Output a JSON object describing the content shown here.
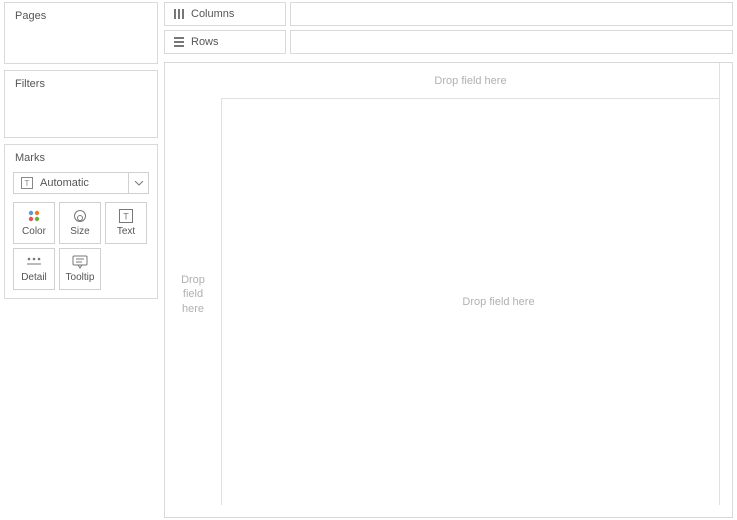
{
  "sidebar": {
    "pages": {
      "title": "Pages"
    },
    "filters": {
      "title": "Filters"
    },
    "marks": {
      "title": "Marks",
      "mark_type": {
        "label": "Automatic"
      },
      "buttons": {
        "color": "Color",
        "size": "Size",
        "text": "Text",
        "detail": "Detail",
        "tooltip": "Tooltip"
      }
    }
  },
  "shelves": {
    "columns": {
      "label": "Columns"
    },
    "rows": {
      "label": "Rows"
    }
  },
  "viz": {
    "col_placeholder": "Drop field here",
    "row_placeholder_l1": "Drop",
    "row_placeholder_l2": "field",
    "row_placeholder_l3": "here",
    "body_placeholder": "Drop field here"
  }
}
